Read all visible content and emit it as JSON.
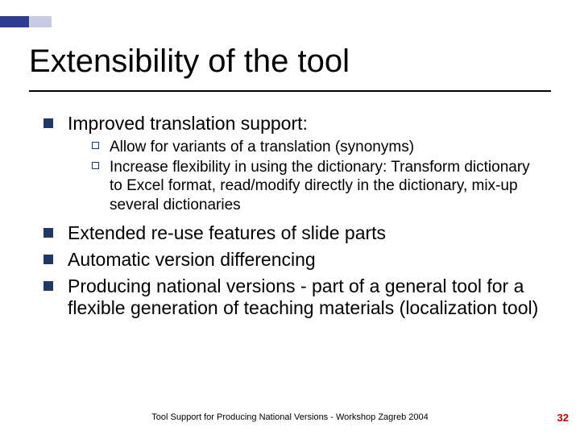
{
  "colors": {
    "accent_dark": "#2f3e93",
    "accent_light": "#c7cbe3",
    "bullet_fill": "#1f3864",
    "pagenum": "#c00000"
  },
  "title": "Extensibility of the tool",
  "bullets": [
    {
      "text": "Improved translation support:",
      "sub": [
        "Allow for variants of a translation (synonyms)",
        "Increase flexibility in using the dictionary: Transform dictionary to Excel format, read/modify directly in the dictionary, mix-up several dictionaries"
      ]
    },
    {
      "text": "Extended re-use features of slide parts"
    },
    {
      "text": "Automatic version differencing"
    },
    {
      "text": "Producing national versions - part of a general tool for a flexible generation of teaching materials (localization tool)"
    }
  ],
  "footer": "Tool Support for Producing National Versions - Workshop Zagreb 2004",
  "page_number": "32"
}
